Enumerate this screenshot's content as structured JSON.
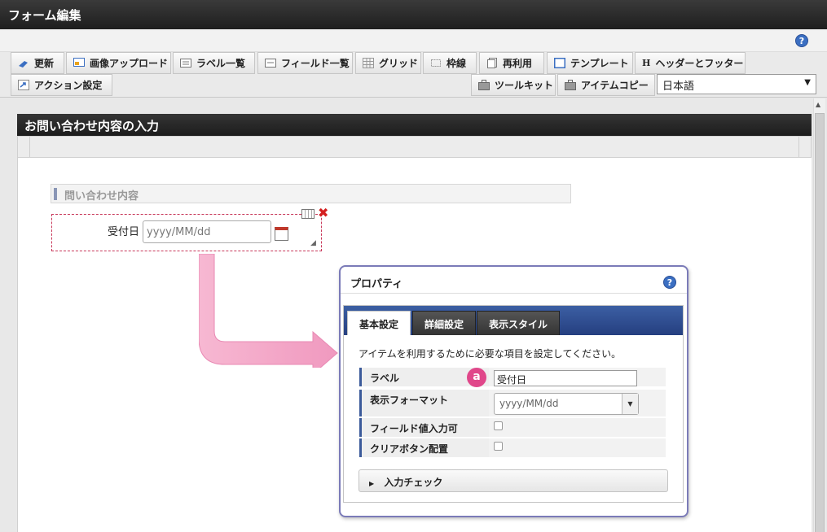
{
  "window": {
    "title": "フォーム編集"
  },
  "toolbar": {
    "row1": [
      "更新",
      "画像アップロード",
      "ラベル一覧",
      "フィールド一覧",
      "グリッド",
      "枠線",
      "再利用",
      "テンプレート",
      "ヘッダーとフッター"
    ],
    "action_settings": "アクション設定",
    "toolkit": "ツールキット",
    "item_copy": "アイテムコピー",
    "language": "日本語"
  },
  "form": {
    "title": "お問い合わせ内容の入力",
    "section": "問い合わせ内容",
    "field_label": "受付日",
    "field_placeholder": "yyyy/MM/dd"
  },
  "properties": {
    "title": "プロパティ",
    "tabs": [
      "基本設定",
      "詳細設定",
      "表示スタイル"
    ],
    "description": "アイテムを利用するために必要な項目を設定してください。",
    "rows": {
      "label": "ラベル",
      "display_format": "表示フォーマット",
      "field_input": "フィールド値入力可",
      "clear_button": "クリアボタン配置"
    },
    "label_value": "受付日",
    "format_value": "yyyy/MM/dd",
    "badge": "a",
    "input_check": "入力チェック"
  },
  "colors": {
    "accent_blue": "#2f4f91",
    "badge_pink": "#e0478a",
    "delete_red": "#d42020"
  }
}
